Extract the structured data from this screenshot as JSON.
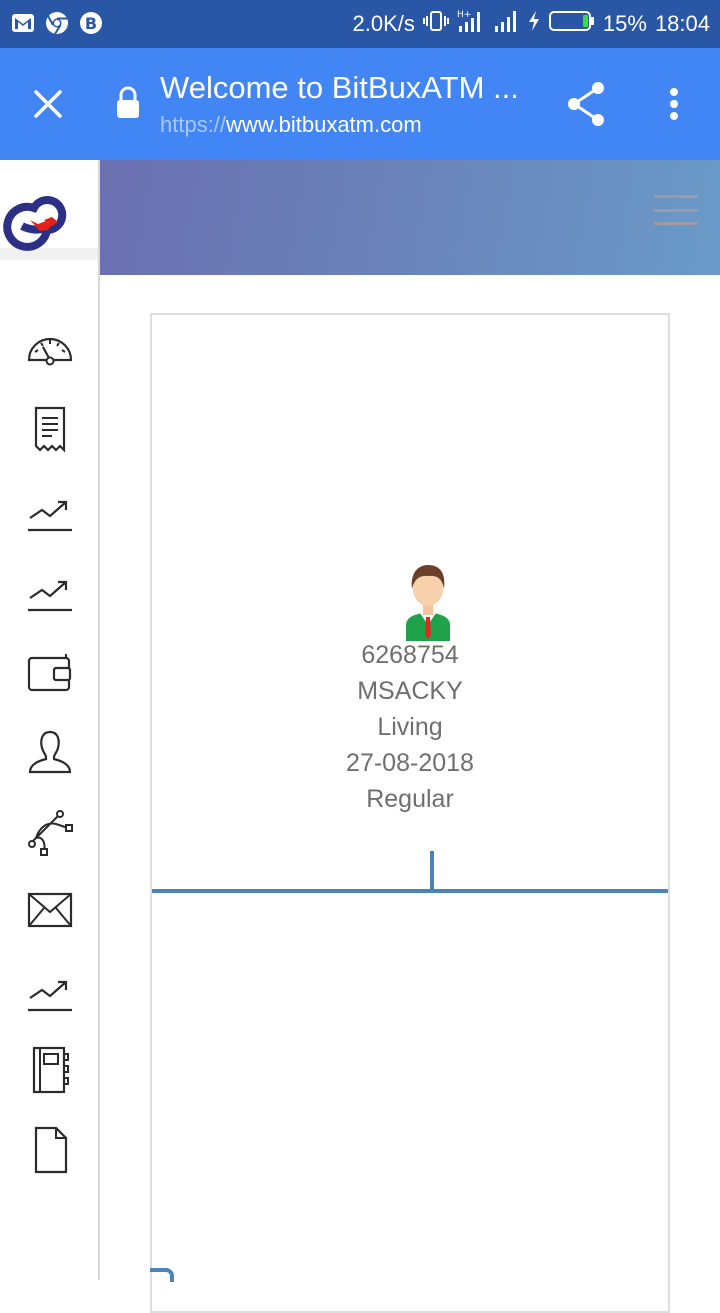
{
  "status_bar": {
    "net_speed": "2.0K/s",
    "battery": "15%",
    "time": "18:04",
    "left_icons": [
      "gmail-icon",
      "chrome-icon",
      "bitcoin-icon"
    ],
    "right_icons": [
      "vibrate-icon",
      "signal-h-plus-icon",
      "signal-icon",
      "charging-icon",
      "battery-icon"
    ]
  },
  "browser": {
    "title": "Welcome to BitBuxATM ...",
    "url_scheme": "https://",
    "url_host": "www.bitbuxatm.com",
    "icons": [
      "close-icon",
      "lock-icon",
      "share-icon",
      "more-vertical-icon"
    ]
  },
  "sidebar": {
    "logo": "bitbux-logo",
    "items": [
      {
        "icon": "dashboard-icon"
      },
      {
        "icon": "receipt-icon"
      },
      {
        "icon": "trending-up-icon"
      },
      {
        "icon": "trending-up-icon"
      },
      {
        "icon": "wallet-icon"
      },
      {
        "icon": "user-icon"
      },
      {
        "icon": "network-icon"
      },
      {
        "icon": "mail-icon"
      },
      {
        "icon": "trending-up-icon"
      },
      {
        "icon": "notebook-icon"
      },
      {
        "icon": "document-icon"
      }
    ]
  },
  "header": {
    "menu_icon": "hamburger-icon",
    "gradient_start": "#6b6fb1",
    "gradient_end": "#6a9bc8"
  },
  "member": {
    "avatar_icon": "user-avatar-icon",
    "id": "6268754",
    "name": "MSACKY",
    "status": "Living",
    "date": "27-08-2018",
    "type": "Regular"
  },
  "colors": {
    "status_bar": "#2a56a6",
    "browser_bar": "#4285f4",
    "tree_line": "#4d84b8",
    "text": "#6f6f6f"
  }
}
